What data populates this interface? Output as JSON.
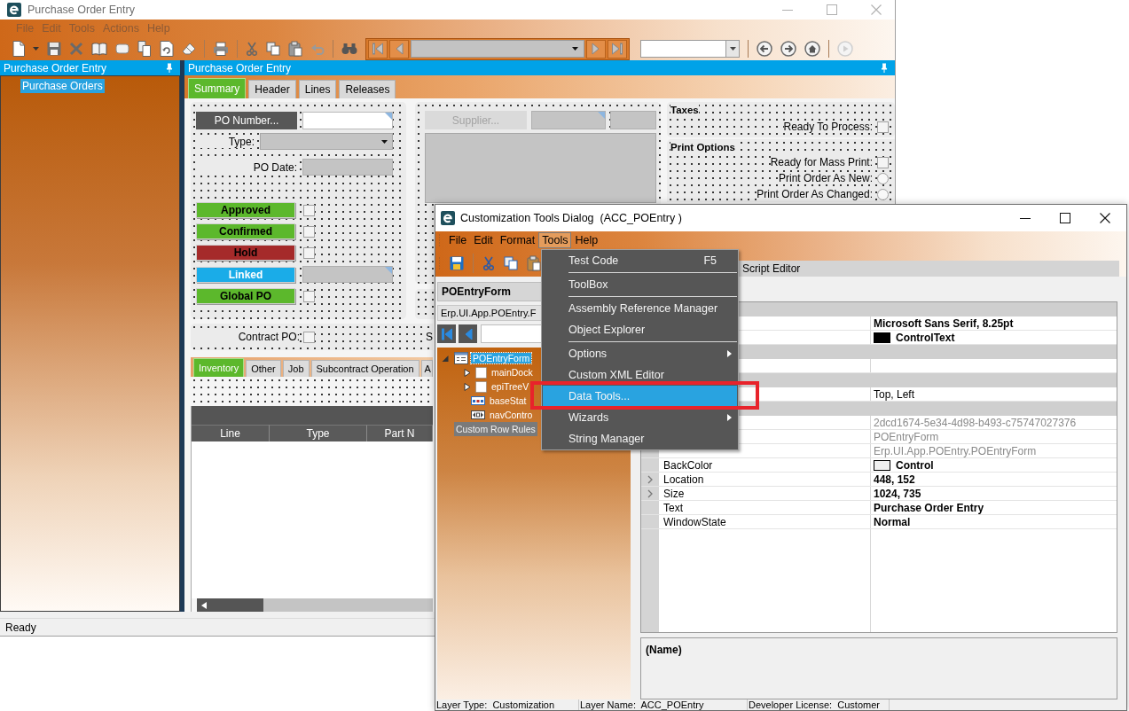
{
  "main_window": {
    "title": "Purchase Order Entry",
    "active": false,
    "menu": [
      {
        "label": "File",
        "selected": false
      },
      {
        "label": "Edit",
        "selected": false
      },
      {
        "label": "Tools",
        "selected": false
      },
      {
        "label": "Actions",
        "selected": false
      },
      {
        "label": "Help",
        "selected": false
      }
    ],
    "left_panel": {
      "title": "Purchase Order Entry",
      "items": [
        {
          "label": "Purchase Orders",
          "selected": true
        }
      ]
    },
    "right_panel": {
      "title": "Purchase Order Entry"
    },
    "tabs": [
      {
        "label": "Summary",
        "selected": true
      },
      {
        "label": "Header",
        "selected": false
      },
      {
        "label": "Lines",
        "selected": false
      },
      {
        "label": "Releases",
        "selected": false
      }
    ],
    "po_number_button": "PO Number...",
    "type_label": "Type:",
    "po_date_label": "PO Date:",
    "flags": [
      {
        "label": "Approved",
        "color": "#5cb82c",
        "kind": "checkbox",
        "checked": false
      },
      {
        "label": "Confirmed",
        "color": "#5cb82c",
        "kind": "checkbox",
        "checked": false
      },
      {
        "label": "Hold",
        "color": "#a52a2a",
        "kind": "checkbox",
        "checked": false
      },
      {
        "label": "Linked",
        "color": "#1aace8",
        "kind": "field"
      },
      {
        "label": "Global PO",
        "color": "#5cb82c",
        "kind": "checkbox",
        "checked": false
      }
    ],
    "supplier_button": {
      "label": "Supplier...",
      "disabled": true
    },
    "contract_po": {
      "label": "Contract PO:",
      "checked": false
    },
    "cut_label": "S",
    "taxes": {
      "title": "Taxes",
      "fields": [
        {
          "label": "Ready To Process:",
          "kind": "checkbox",
          "checked": false
        }
      ]
    },
    "print_options": {
      "title": "Print Options",
      "fields": [
        {
          "label": "Ready for Mass Print:",
          "kind": "checkbox",
          "checked": false
        },
        {
          "label": "Print Order As New:",
          "kind": "radio",
          "selected": false
        },
        {
          "label": "Print Order As Changed:",
          "kind": "radio",
          "selected": false
        }
      ]
    },
    "detail_tabs": [
      {
        "label": "Inventory",
        "selected": true
      },
      {
        "label": "Other",
        "selected": false
      },
      {
        "label": "Job",
        "selected": false
      },
      {
        "label": "Subcontract Operation",
        "selected": false
      },
      {
        "label": "A",
        "selected": false
      }
    ],
    "grid": {
      "columns": [
        "Line",
        "Type",
        "Part N"
      ]
    },
    "status_bar": "Ready"
  },
  "dialog": {
    "title": "Customization Tools Dialog  (ACC_POEntry )",
    "active": true,
    "menu": [
      {
        "label": "File",
        "selected": false
      },
      {
        "label": "Edit",
        "selected": false
      },
      {
        "label": "Format",
        "selected": false
      },
      {
        "label": "Tools",
        "selected": true
      },
      {
        "label": "Help",
        "selected": false
      }
    ],
    "tabs": [
      {
        "label": "Script Editor",
        "selected": false
      }
    ],
    "form_name": "POEntryForm",
    "form_type": "Erp.UI.App.POEntry.F",
    "tree": [
      {
        "label": "POEntryForm",
        "kind": "form",
        "selected": true,
        "expanded": true,
        "children": [
          {
            "label": "mainDock",
            "kind": "panel",
            "selected": false,
            "expanded": false
          },
          {
            "label": "epiTreeV",
            "kind": "panel",
            "selected": false,
            "expanded": false
          },
          {
            "label": "baseStat",
            "kind": "status_bar",
            "selected": false
          },
          {
            "label": "navContro",
            "kind": "navigator",
            "selected": false
          }
        ]
      }
    ],
    "tree_footer": "Custom Row Rules",
    "properties": [
      {
        "kind": "category"
      },
      {
        "kind": "property",
        "value": "Microsoft Sans Serif, 8.25pt",
        "bold": true
      },
      {
        "kind": "property",
        "value": "ControlText",
        "color": "#000000",
        "bold": true
      },
      {
        "kind": "category"
      },
      {
        "kind": "property"
      },
      {
        "kind": "category"
      },
      {
        "kind": "property",
        "value": "Top, Left",
        "bold": false
      },
      {
        "kind": "category"
      },
      {
        "kind": "property",
        "value": "2dcd1674-5e34-4d98-b493-c75747027376",
        "readonly": true
      },
      {
        "kind": "property",
        "value": "POEntryForm",
        "readonly": true
      },
      {
        "kind": "property",
        "value": "Erp.UI.App.POEntry.POEntryForm",
        "readonly": true
      },
      {
        "kind": "property",
        "name": "BackColor",
        "value": "Control",
        "color": "#f0f0f0",
        "bold": true
      },
      {
        "kind": "property",
        "name": "Location",
        "value": "448, 152",
        "bold": true,
        "expanded": false
      },
      {
        "kind": "property",
        "name": "Size",
        "value": "1024, 735",
        "bold": true,
        "expanded": false
      },
      {
        "kind": "property",
        "name": "Text",
        "value": "Purchase Order Entry",
        "bold": true
      },
      {
        "kind": "property",
        "name": "WindowState",
        "value": "Normal",
        "bold": true
      }
    ],
    "description": "(Name)",
    "status_bar": [
      "Layer Type:  Customization",
      "Layer Name:  ACC_POEntry",
      "Developer License:  Customer"
    ]
  },
  "tools_menu": {
    "items": [
      {
        "kind": "item",
        "label": "Test Code",
        "shortcut": "F5",
        "selected": false
      },
      {
        "kind": "separator"
      },
      {
        "kind": "item",
        "label": "ToolBox",
        "selected": false
      },
      {
        "kind": "separator"
      },
      {
        "kind": "item",
        "label": "Assembly Reference Manager",
        "selected": false
      },
      {
        "kind": "item",
        "label": "Object Explorer",
        "selected": false
      },
      {
        "kind": "separator"
      },
      {
        "kind": "submenu",
        "label": "Options",
        "selected": false
      },
      {
        "kind": "item",
        "label": "Custom XML Editor",
        "selected": false
      },
      {
        "kind": "item",
        "label": "Data Tools...",
        "selected": true
      },
      {
        "kind": "submenu",
        "label": "Wizards",
        "selected": false
      },
      {
        "kind": "item",
        "label": "String Manager",
        "selected": false
      }
    ]
  }
}
